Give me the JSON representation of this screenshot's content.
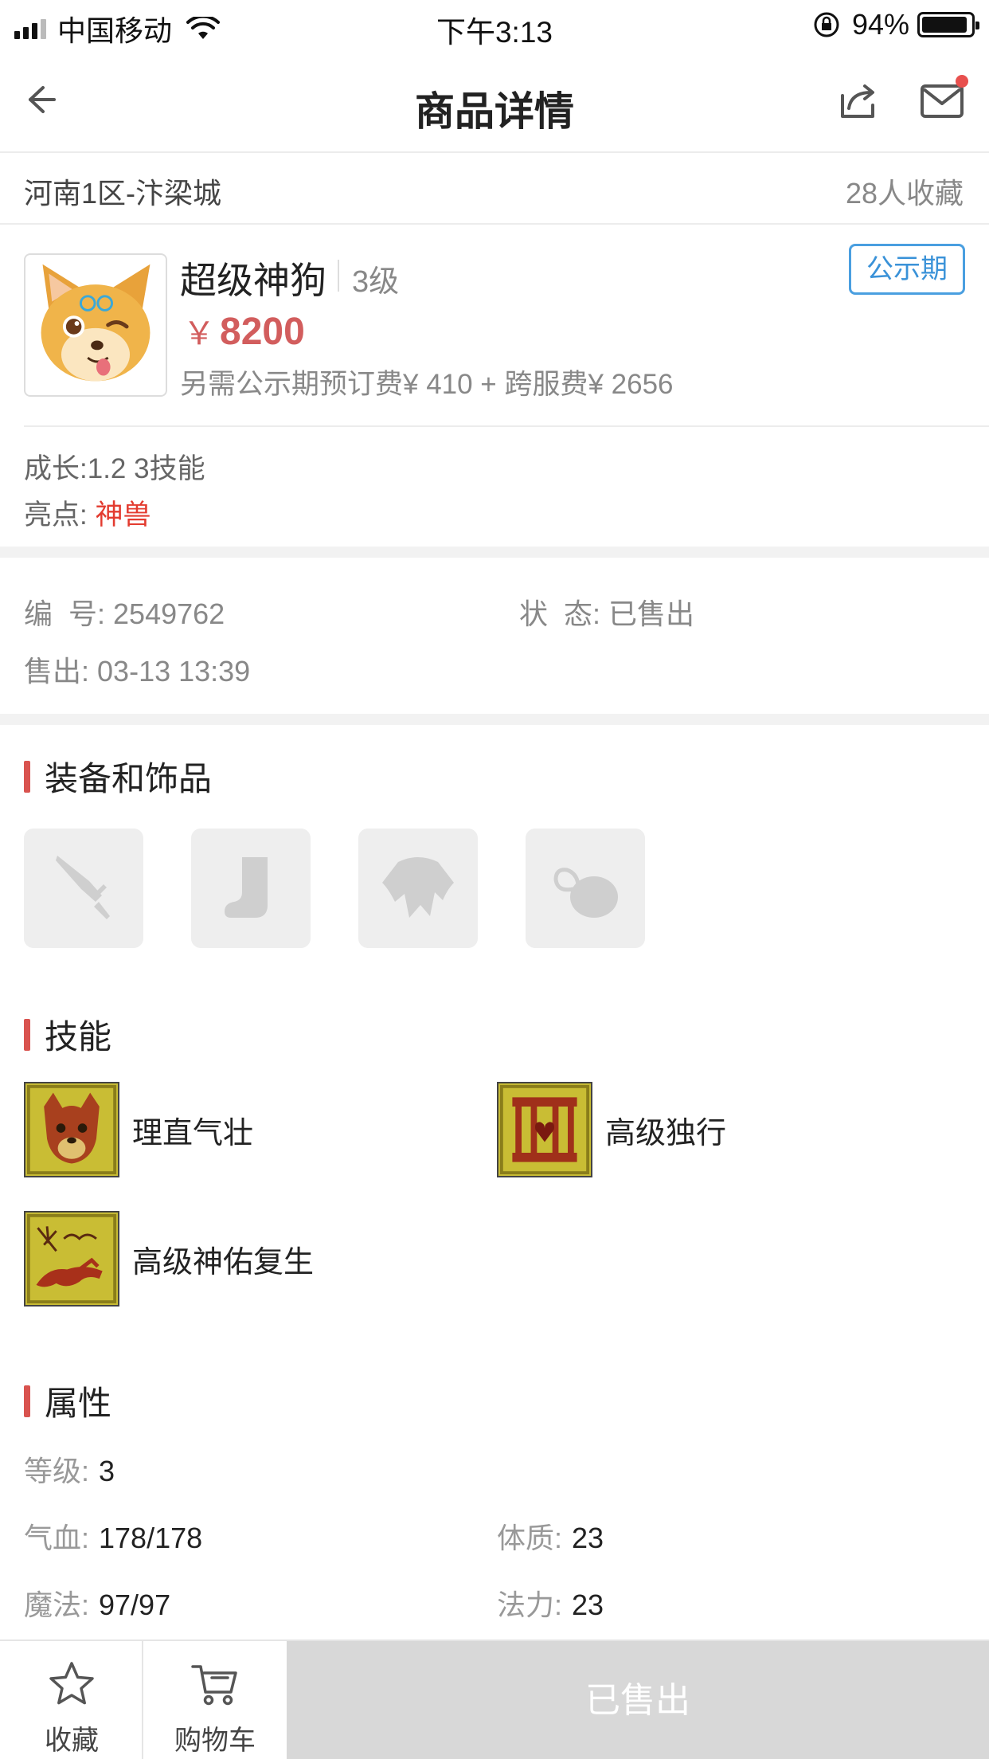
{
  "status_bar": {
    "carrier": "中国移动",
    "time": "下午3:13",
    "battery": "94%",
    "battery_level": 0.94
  },
  "nav": {
    "title": "商品详情",
    "back_icon": "back-arrow-icon",
    "share_icon": "share-icon",
    "mail_icon": "mail-icon"
  },
  "server": {
    "name": "河南1区-汴梁城",
    "fav_count": "28人收藏"
  },
  "product": {
    "name": "超级神狗",
    "level": "3级",
    "badge": "公示期",
    "currency": "￥",
    "price": "8200",
    "extra_fee": "另需公示期预订费¥ 410 + 跨服费¥ 2656"
  },
  "traits": {
    "growth": "成长:1.2 3技能",
    "highlight_label": "亮点:",
    "highlight_value": "神兽"
  },
  "info": {
    "id_label": "编  号:",
    "id_value": "2549762",
    "status_label": "状  态:",
    "status_value": "已售出",
    "sold_label": "售出:",
    "sold_value": "03-13 13:39"
  },
  "equipment": {
    "title": "装备和饰品",
    "slots": [
      "weapon-slot-icon",
      "boots-slot-icon",
      "armor-slot-icon",
      "accessory-slot-icon"
    ]
  },
  "skills": {
    "title": "技能",
    "items": [
      {
        "name": "理直气壮",
        "icon": "skill-dog-icon"
      },
      {
        "name": "高级独行",
        "icon": "skill-cage-icon"
      },
      {
        "name": "高级神佑复生",
        "icon": "skill-revive-icon"
      }
    ]
  },
  "attributes": {
    "title": "属性",
    "level_label": "等级:",
    "level_value": "3",
    "hp_label": "气血:",
    "hp_value": "178/178",
    "con_label": "体质:",
    "con_value": "23",
    "mp_label": "魔法:",
    "mp_value": "97/97",
    "mag_label": "法力:",
    "mag_value": "23"
  },
  "bottom": {
    "favorite": "收藏",
    "cart": "购物车",
    "sold": "已售出"
  },
  "colors": {
    "accent_red": "#d9534f",
    "price_red": "#d25d5d",
    "badge_blue": "#3a92d8",
    "highlight_red": "#e33b2f"
  }
}
